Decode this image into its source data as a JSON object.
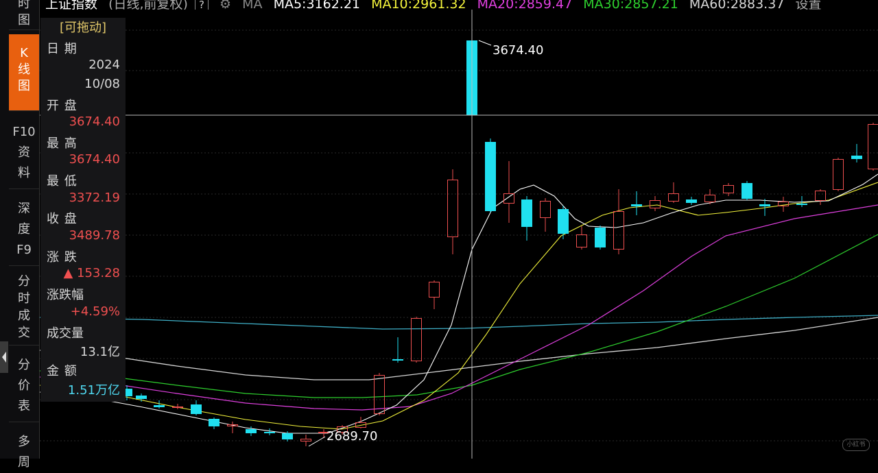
{
  "sidebar": {
    "tabs": [
      {
        "label": "分时图",
        "lines": [
          "时",
          "图"
        ],
        "active": false
      },
      {
        "label": "K线图",
        "lines": [
          "K",
          "线",
          "图"
        ],
        "active": true
      },
      {
        "label": "F10资料",
        "lines": [
          "F10",
          "资",
          "料"
        ],
        "active": false
      },
      {
        "label": "深度F9",
        "lines": [
          "深",
          "度",
          "F9"
        ],
        "active": false
      },
      {
        "label": "分时成交",
        "lines": [
          "分",
          "时",
          "成",
          "交"
        ],
        "active": false
      },
      {
        "label": "分价表",
        "lines": [
          "分",
          "价",
          "表"
        ],
        "active": false
      },
      {
        "label": "多周期",
        "lines": [
          "多",
          "周"
        ],
        "active": false
      }
    ]
  },
  "topbar": {
    "title": "上证指数",
    "mode": "(日线,前复权)",
    "help": "?",
    "ma_label": "MA",
    "ma": [
      {
        "text": "MA5:3162.21",
        "color": "#ffffff"
      },
      {
        "text": "MA10:2961.32",
        "color": "#f5f53c"
      },
      {
        "text": "MA20:2859.47",
        "color": "#e040e0"
      },
      {
        "text": "MA30:2857.21",
        "color": "#2ed02e"
      },
      {
        "text": "MA60:2883.37",
        "color": "#d8d8d8"
      }
    ],
    "settings": "设置"
  },
  "info": {
    "header": "[可拖动]",
    "date_label": "日 期",
    "date_year": "2024",
    "date_md": "10/08",
    "open_label": "开 盘",
    "open": "3674.40",
    "high_label": "最 高",
    "high": "3674.40",
    "low_label": "最 低",
    "low": "3372.19",
    "close_label": "收 盘",
    "close": "3489.78",
    "change_label": "涨 跌",
    "change": "▲ 153.28",
    "pct_label": "涨跌幅",
    "pct": "+4.59%",
    "volume_label": "成交量",
    "volume": "13.1亿",
    "amount_label": "金 额",
    "amount": "1.51万亿"
  },
  "chart_annotations": {
    "high_label": "3674.40",
    "low_label": "2689.70"
  },
  "colors": {
    "up": "#f05050",
    "down": "#20e0f0",
    "ma5": "#ffffff",
    "ma10": "#f5f53c",
    "ma20": "#e040e0",
    "ma30": "#2ed02e",
    "ma60": "#d8d8d8",
    "ma120": "#3fb0c8",
    "accent": "#e8600f"
  },
  "watermark": "小红书"
}
